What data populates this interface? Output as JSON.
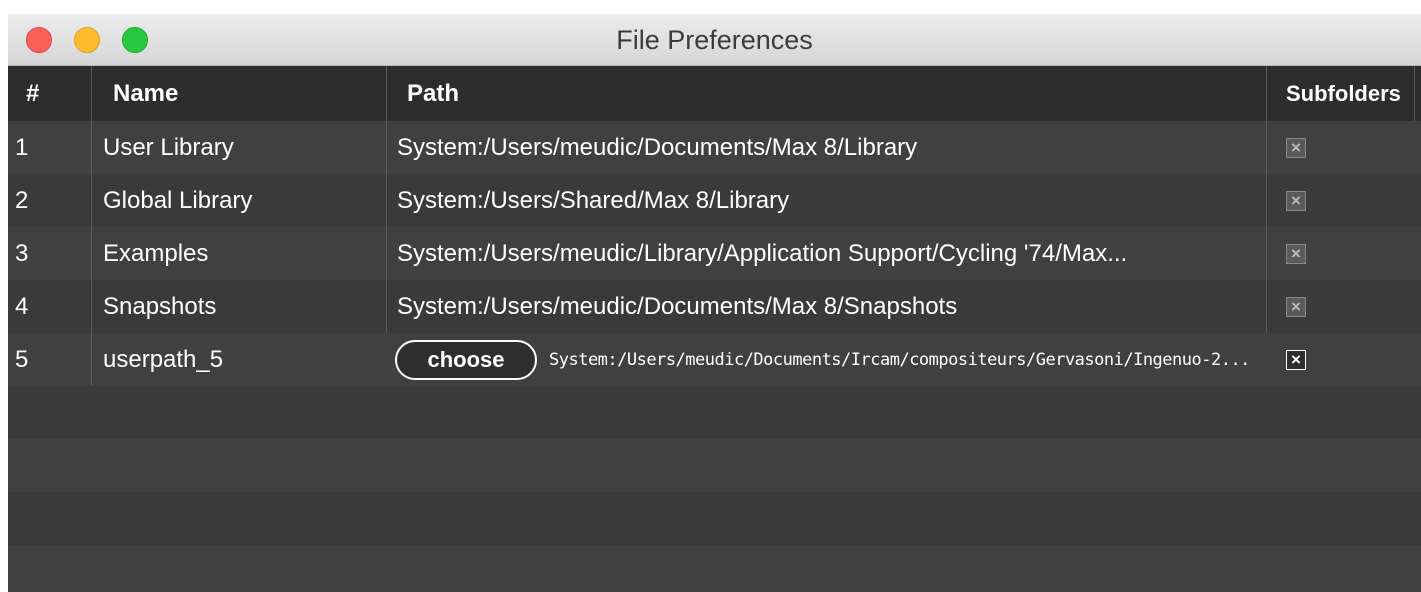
{
  "window": {
    "title": "File Preferences"
  },
  "columns": {
    "num": "#",
    "name": "Name",
    "path": "Path",
    "subfolders": "Subfolders"
  },
  "rows": [
    {
      "num": "1",
      "name": "User Library",
      "path": "System:/Users/meudic/Documents/Max 8/Library",
      "subfolders": true
    },
    {
      "num": "2",
      "name": "Global Library",
      "path": "System:/Users/Shared/Max 8/Library",
      "subfolders": true
    },
    {
      "num": "3",
      "name": "Examples",
      "path": "System:/Users/meudic/Library/Application Support/Cycling '74/Max...",
      "subfolders": true
    },
    {
      "num": "4",
      "name": "Snapshots",
      "path": "System:/Users/meudic/Documents/Max 8/Snapshots",
      "subfolders": true
    },
    {
      "num": "5",
      "name": "userpath_5",
      "choose_label": "choose",
      "path": "System:/Users/meudic/Documents/Ircam/compositeurs/Gervasoni/Ingenuo-2...",
      "subfolders": true
    }
  ],
  "icons": {
    "checkbox": "×"
  }
}
